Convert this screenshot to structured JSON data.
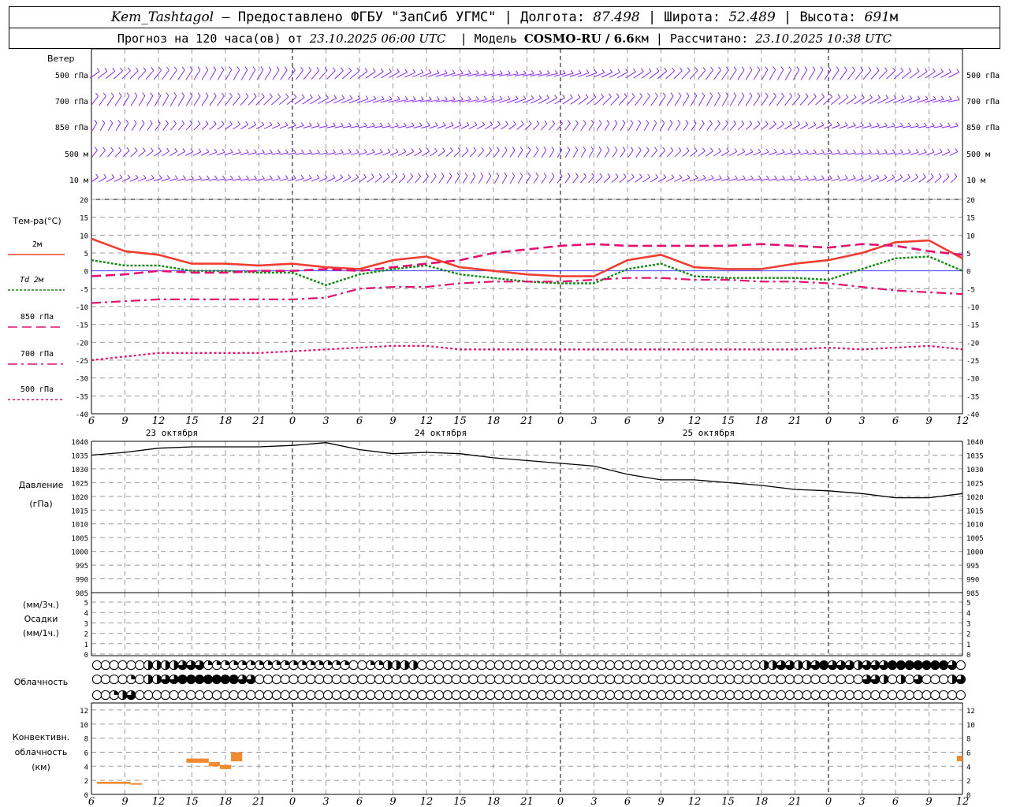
{
  "header": {
    "station": "Kem_Tashtagol",
    "provided_by": "Предоставлено ФГБУ \"ЗапСиб УГМС\"",
    "lon_label": "Долгота:",
    "lon": "87.498",
    "lat_label": "Широта:",
    "lat": "52.489",
    "alt_label": "Высота:",
    "alt": "691",
    "alt_unit": "м",
    "forecast_label": "Прогноз на 120 часа(ов) от",
    "forecast_start": "23.10.2025 06:00 UTC",
    "model_label": "Модель",
    "model": "COSMO-RU / 6.6",
    "model_unit": "км",
    "computed_label": "Рассчитано:",
    "computed": "23.10.2025 10:38 UTC"
  },
  "labels": {
    "wind": "Ветер",
    "wind_levels": [
      "500 гПа",
      "700 гПа",
      "850 гПа",
      "500 м",
      "10  м"
    ],
    "temp_title": "Тем-ра(°C)",
    "temp_legend": [
      "2м",
      "Td  2м",
      "850 гПа",
      "700 гПа",
      "500 гПа"
    ],
    "pressure": [
      "Давление",
      "(гПа)"
    ],
    "precip": [
      "(мм/3ч.)",
      "Осадки",
      "(мм/1ч.)"
    ],
    "cloud": "Облачность",
    "conv": [
      "Конвективн.",
      "облачность",
      "(км)"
    ],
    "days": [
      "23 октября",
      "24 октября",
      "25 октября"
    ]
  },
  "colors": {
    "t2m": "#ee3e32",
    "td2m": "#138a13",
    "t850": "#e0116f",
    "t700": "#e0116f",
    "t500": "#e0116f",
    "wind": "#8a2be2",
    "pressure": "#000000",
    "conv": "#f08a30",
    "grid": "#9b9b9b"
  },
  "chart_data": [
    {
      "type": "line",
      "panel": "temperature",
      "x_hours": [
        0,
        3,
        6,
        9,
        12,
        15,
        18,
        21,
        24,
        27,
        30,
        33,
        36,
        39,
        42,
        45,
        48,
        51,
        54,
        57,
        60,
        63,
        66,
        69,
        72,
        75,
        78
      ],
      "x_tick_labels": [
        "6",
        "9",
        "12",
        "15",
        "18",
        "21",
        "0",
        "3",
        "6",
        "9",
        "12",
        "15",
        "18",
        "21",
        "0",
        "3",
        "6",
        "9",
        "12",
        "15",
        "18",
        "21",
        "0",
        "3",
        "6",
        "9",
        "12"
      ],
      "ylim": [
        -40,
        20
      ],
      "yticks": [
        20,
        15,
        10,
        5,
        0,
        -5,
        -10,
        -15,
        -20,
        -25,
        -30,
        -35,
        -40
      ],
      "series": [
        {
          "name": "2м",
          "values": [
            9,
            5.5,
            4.5,
            2,
            2,
            1.5,
            2,
            1,
            0.5,
            3,
            4,
            1,
            0,
            -1,
            -1.5,
            -1.5,
            3,
            4.5,
            1,
            0.5,
            0.5,
            2,
            3,
            5,
            8,
            8.5,
            3.5
          ]
        },
        {
          "name": "Td  2м",
          "values": [
            3,
            1.5,
            1.5,
            0,
            0,
            -0.5,
            -0.5,
            -4,
            -1,
            0.5,
            1.5,
            -1,
            -2,
            -3,
            -3.5,
            -3.5,
            0.5,
            2,
            -1.5,
            -2,
            -2,
            -2,
            -2.5,
            0.5,
            3.5,
            4,
            0
          ]
        },
        {
          "name": "850 гПа",
          "values": [
            -1.5,
            -1,
            0,
            -0.5,
            -0.5,
            0,
            0,
            0.5,
            0,
            1,
            2,
            3,
            5,
            6,
            7,
            7.5,
            7,
            7,
            7,
            7,
            7.5,
            7,
            6.5,
            7.5,
            7,
            5.5,
            4.5
          ]
        },
        {
          "name": "700 гПа",
          "values": [
            -9,
            -8.5,
            -8,
            -8,
            -8,
            -8,
            -8,
            -7.5,
            -5,
            -4.5,
            -4.5,
            -3.5,
            -3,
            -3,
            -3,
            -2.5,
            -2,
            -2,
            -2.5,
            -2.5,
            -3,
            -3,
            -3.5,
            -4.5,
            -5.5,
            -6,
            -6.5
          ]
        },
        {
          "name": "500 гПа",
          "values": [
            -25,
            -24,
            -23,
            -23,
            -23,
            -23,
            -22.5,
            -22,
            -21.5,
            -21,
            -21,
            -22,
            -22,
            -22,
            -22,
            -22,
            -22,
            -22,
            -22,
            -22,
            -22,
            -22,
            -21.5,
            -22,
            -21.5,
            -21,
            -22
          ]
        }
      ]
    },
    {
      "type": "line",
      "panel": "pressure",
      "x_hours": [
        0,
        3,
        6,
        9,
        12,
        15,
        18,
        21,
        24,
        27,
        30,
        33,
        36,
        39,
        42,
        45,
        48,
        51,
        54,
        57,
        60,
        63,
        66,
        69,
        72,
        75,
        78
      ],
      "ylim": [
        985,
        1040
      ],
      "yticks": [
        1040,
        1035,
        1030,
        1025,
        1020,
        1015,
        1010,
        1005,
        1000,
        995,
        990,
        985
      ],
      "series": [
        {
          "name": "Давление",
          "values": [
            1035,
            1036,
            1037.5,
            1038,
            1038,
            1038,
            1038.5,
            1039.5,
            1037,
            1035.5,
            1036,
            1035.5,
            1034,
            1033,
            1032,
            1031,
            1028,
            1026,
            1026,
            1025,
            1024,
            1022.5,
            1022,
            1021,
            1019.5,
            1019.5,
            1021
          ]
        }
      ]
    },
    {
      "type": "bar",
      "panel": "precipitation",
      "ylim": [
        0,
        5
      ],
      "yticks": [
        5,
        4,
        3,
        2,
        1,
        0
      ],
      "values": []
    },
    {
      "type": "bar",
      "panel": "convective_cloud",
      "ylim": [
        0,
        13
      ],
      "yticks": [
        12,
        10,
        8,
        6,
        4,
        2,
        0
      ],
      "segments": [
        {
          "x0": 0.5,
          "x1": 3.5,
          "base": 1.5,
          "top": 1.8
        },
        {
          "x0": 3.5,
          "x1": 4.5,
          "base": 1.4,
          "top": 1.6
        },
        {
          "x0": 8.5,
          "x1": 10.5,
          "base": 4.5,
          "top": 5.1
        },
        {
          "x0": 10.5,
          "x1": 11.5,
          "base": 4.0,
          "top": 4.6
        },
        {
          "x0": 11.5,
          "x1": 12.5,
          "base": 3.6,
          "top": 4.2
        },
        {
          "x0": 12.5,
          "x1": 13.5,
          "base": 4.7,
          "top": 6.0
        },
        {
          "x0": 77.5,
          "x1": 78,
          "base": 4.7,
          "top": 5.5
        }
      ]
    }
  ],
  "cloud_rows": {
    "high": [
      0,
      0,
      0,
      0,
      0,
      0,
      2,
      2,
      2,
      2,
      3,
      3,
      3,
      1,
      1,
      1,
      1,
      1,
      1,
      1,
      1,
      1,
      1,
      1,
      1,
      1,
      1,
      1,
      1,
      1,
      0,
      0,
      1,
      1,
      2,
      2,
      2,
      2,
      0,
      0,
      0,
      0,
      0,
      0,
      0,
      0,
      0,
      0,
      0,
      0,
      0,
      0,
      0,
      0,
      0,
      0,
      0,
      0,
      0,
      0,
      0,
      0,
      0,
      0,
      0,
      0,
      0,
      0,
      0,
      0,
      0,
      0,
      0,
      0,
      0,
      0,
      0,
      0,
      2,
      2,
      3,
      3,
      2,
      2,
      3,
      4,
      3,
      3,
      3,
      2,
      3,
      3,
      3,
      4,
      4,
      4,
      4,
      4,
      4,
      4,
      3
    ],
    "mid": [
      0,
      0,
      0,
      0,
      1,
      0,
      2,
      2,
      3,
      3,
      4,
      4,
      4,
      4,
      4,
      4,
      4,
      3,
      3,
      0,
      0,
      0,
      0,
      0,
      0,
      0,
      0,
      0,
      0,
      0,
      0,
      0,
      0,
      0,
      0,
      0,
      0,
      0,
      0,
      0,
      0,
      0,
      0,
      0,
      0,
      0,
      0,
      0,
      0,
      0,
      0,
      0,
      0,
      0,
      0,
      0,
      0,
      0,
      0,
      0,
      0,
      0,
      0,
      0,
      0,
      0,
      0,
      0,
      0,
      0,
      0,
      0,
      0,
      0,
      0,
      0,
      0,
      0,
      0,
      0,
      0,
      0,
      0,
      0,
      0,
      0,
      0,
      0,
      0,
      0,
      3,
      3,
      2,
      0,
      2,
      0,
      3,
      0,
      0,
      0,
      2,
      3,
      4
    ],
    "low": [
      0,
      0,
      1,
      2,
      3,
      0,
      0,
      0,
      0,
      0,
      0,
      0,
      0,
      0,
      0,
      0,
      0,
      0,
      0,
      0,
      0,
      0,
      0,
      0,
      0,
      0,
      0,
      0,
      0,
      0,
      0,
      0,
      0,
      0,
      0,
      0,
      0,
      0,
      0,
      0,
      0,
      0,
      0,
      0,
      0,
      0,
      0,
      0,
      0,
      0,
      0,
      0,
      0,
      0,
      0,
      0,
      0,
      0,
      0,
      0,
      0,
      0,
      0,
      0,
      0,
      0,
      0,
      0,
      0,
      0,
      0,
      0,
      0,
      0,
      0,
      0,
      0,
      0,
      0,
      0,
      0,
      0,
      0,
      0,
      0,
      0,
      0,
      0,
      0,
      0,
      0,
      0,
      0,
      0,
      0,
      0,
      0,
      0,
      0,
      0,
      0,
      0,
      0,
      0,
      0,
      0,
      0,
      0
    ]
  }
}
